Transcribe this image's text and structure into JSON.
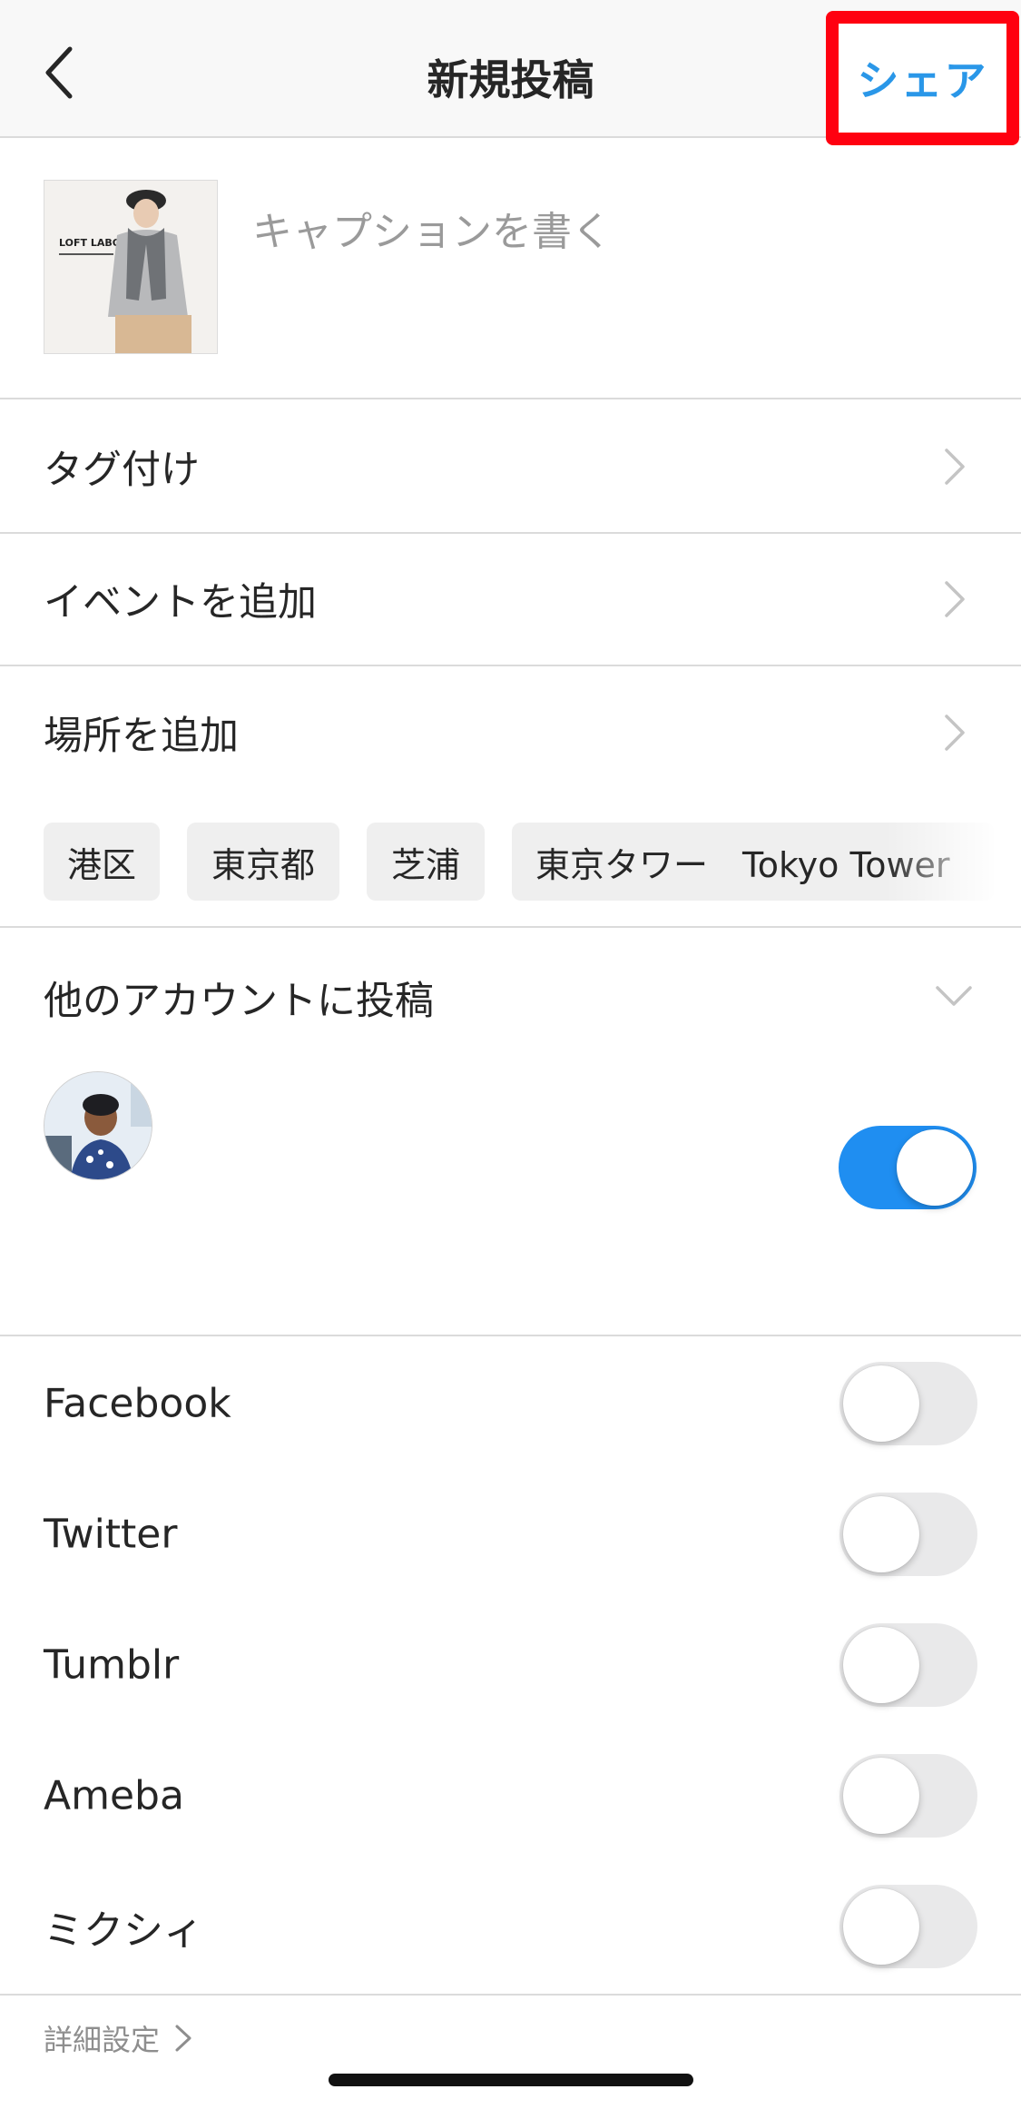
{
  "header": {
    "title": "新規投稿",
    "share_label": "シェア"
  },
  "caption": {
    "placeholder": "キャプションを書く",
    "thumbnail_brand": "LOFT LABO"
  },
  "rows": {
    "tag": "タグ付け",
    "event": "イベントを追加",
    "location": "場所を追加"
  },
  "location_chips": [
    "港区",
    "東京都",
    "芝浦",
    "東京タワー　Tokyo Tower"
  ],
  "other_accounts": {
    "title": "他のアカウントに投稿",
    "toggle_on": true
  },
  "share_targets": [
    {
      "label": "Facebook",
      "on": false
    },
    {
      "label": "Twitter",
      "on": false
    },
    {
      "label": "Tumblr",
      "on": false
    },
    {
      "label": "Ameba",
      "on": false
    },
    {
      "label": "ミクシィ",
      "on": false
    }
  ],
  "advanced": {
    "label": "詳細設定"
  },
  "colors": {
    "accent": "#2a97e8",
    "toggle_on": "#1f8ef1",
    "highlight_box": "#ff0010"
  },
  "icons": {
    "back": "chevron-left-icon",
    "row_arrow": "chevron-right-icon",
    "expand": "chevron-down-icon"
  }
}
